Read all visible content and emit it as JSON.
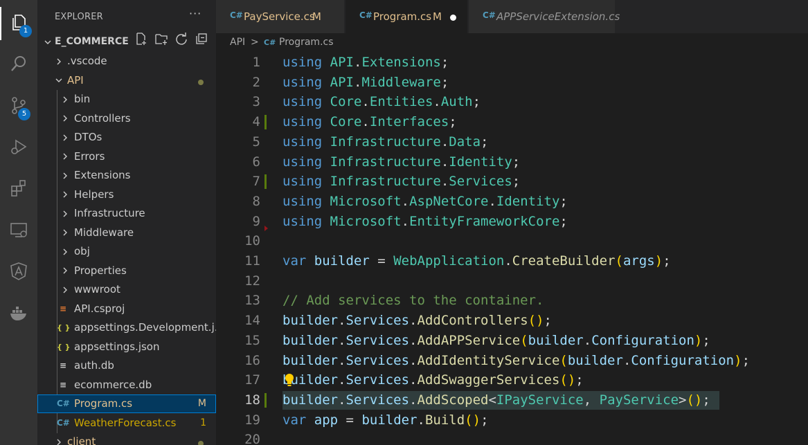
{
  "activity_bar": {
    "items": [
      {
        "name": "explorer-icon",
        "badge": "1"
      },
      {
        "name": "search-icon",
        "badge": null
      },
      {
        "name": "source-control-icon",
        "badge": "5"
      },
      {
        "name": "run-debug-icon",
        "badge": null
      },
      {
        "name": "extensions-icon",
        "badge": null
      },
      {
        "name": "remote-explorer-icon",
        "badge": null
      },
      {
        "name": "angular-icon",
        "badge": null
      },
      {
        "name": "docker-icon",
        "badge": null
      }
    ]
  },
  "sidebar": {
    "title": "EXPLORER",
    "more": "···",
    "project": "E_COMMERCE",
    "items": [
      {
        "label": ".vscode",
        "type": "folder"
      },
      {
        "label": "API",
        "type": "folder-open",
        "status": "dot"
      },
      {
        "label": "bin",
        "type": "folder"
      },
      {
        "label": "Controllers",
        "type": "folder"
      },
      {
        "label": "DTOs",
        "type": "folder"
      },
      {
        "label": "Errors",
        "type": "folder"
      },
      {
        "label": "Extensions",
        "type": "folder"
      },
      {
        "label": "Helpers",
        "type": "folder"
      },
      {
        "label": "Infrastructure",
        "type": "folder"
      },
      {
        "label": "Middleware",
        "type": "folder"
      },
      {
        "label": "obj",
        "type": "folder"
      },
      {
        "label": "Properties",
        "type": "folder"
      },
      {
        "label": "wwwroot",
        "type": "folder"
      },
      {
        "label": "API.csproj",
        "type": "rss"
      },
      {
        "label": "appsettings.Development.j...",
        "type": "json"
      },
      {
        "label": "appsettings.json",
        "type": "json"
      },
      {
        "label": "auth.db",
        "type": "db"
      },
      {
        "label": "ecommerce.db",
        "type": "db"
      },
      {
        "label": "Program.cs",
        "type": "cs",
        "status": "M",
        "selected": true
      },
      {
        "label": "WeatherForecast.cs",
        "type": "cs",
        "status": "1"
      },
      {
        "label": "client",
        "type": "folder",
        "status": "dot"
      }
    ]
  },
  "tabs": [
    {
      "icon": "C#",
      "label": "PayService.cs",
      "modified": "M"
    },
    {
      "icon": "C#",
      "label": "Program.cs",
      "modified": "M",
      "active": true
    },
    {
      "icon": "C#",
      "label": "APPServiceExtension.cs"
    }
  ],
  "breadcrumb": {
    "folder": "API",
    "sep": ">",
    "icon": "C#",
    "file": "Program.cs"
  },
  "code": {
    "lines": [
      {
        "n": "1",
        "tokens": [
          [
            "k",
            "using"
          ],
          [
            "w",
            " "
          ],
          [
            "ns",
            "API"
          ],
          [
            "w",
            "."
          ],
          [
            "ns",
            "Extensions"
          ],
          [
            "w",
            ";"
          ]
        ]
      },
      {
        "n": "2",
        "tokens": [
          [
            "k",
            "using"
          ],
          [
            "w",
            " "
          ],
          [
            "ns",
            "API"
          ],
          [
            "w",
            "."
          ],
          [
            "ns",
            "Middleware"
          ],
          [
            "w",
            ";"
          ]
        ]
      },
      {
        "n": "3",
        "tokens": [
          [
            "k",
            "using"
          ],
          [
            "w",
            " "
          ],
          [
            "ns",
            "Core"
          ],
          [
            "w",
            "."
          ],
          [
            "ns",
            "Entities"
          ],
          [
            "w",
            "."
          ],
          [
            "ns",
            "Auth"
          ],
          [
            "w",
            ";"
          ]
        ]
      },
      {
        "n": "4",
        "git": "added",
        "tokens": [
          [
            "k",
            "using"
          ],
          [
            "w",
            " "
          ],
          [
            "ns",
            "Core"
          ],
          [
            "w",
            "."
          ],
          [
            "ns",
            "Interfaces"
          ],
          [
            "w",
            ";"
          ]
        ]
      },
      {
        "n": "5",
        "tokens": [
          [
            "k",
            "using"
          ],
          [
            "w",
            " "
          ],
          [
            "ns",
            "Infrastructure"
          ],
          [
            "w",
            "."
          ],
          [
            "ns",
            "Data"
          ],
          [
            "w",
            ";"
          ]
        ]
      },
      {
        "n": "6",
        "tokens": [
          [
            "k",
            "using"
          ],
          [
            "w",
            " "
          ],
          [
            "ns",
            "Infrastructure"
          ],
          [
            "w",
            "."
          ],
          [
            "ns",
            "Identity"
          ],
          [
            "w",
            ";"
          ]
        ]
      },
      {
        "n": "7",
        "git": "added",
        "tokens": [
          [
            "k",
            "using"
          ],
          [
            "w",
            " "
          ],
          [
            "ns",
            "Infrastructure"
          ],
          [
            "w",
            "."
          ],
          [
            "ns",
            "Services"
          ],
          [
            "w",
            ";"
          ]
        ]
      },
      {
        "n": "8",
        "tokens": [
          [
            "k",
            "using"
          ],
          [
            "w",
            " "
          ],
          [
            "ns",
            "Microsoft"
          ],
          [
            "w",
            "."
          ],
          [
            "ns",
            "AspNetCore"
          ],
          [
            "w",
            "."
          ],
          [
            "ns",
            "Identity"
          ],
          [
            "w",
            ";"
          ]
        ]
      },
      {
        "n": "9",
        "git": "deleted",
        "tokens": [
          [
            "k",
            "using"
          ],
          [
            "w",
            " "
          ],
          [
            "ns",
            "Microsoft"
          ],
          [
            "w",
            "."
          ],
          [
            "ns",
            "EntityFrameworkCore"
          ],
          [
            "w",
            ";"
          ]
        ]
      },
      {
        "n": "10",
        "tokens": []
      },
      {
        "n": "11",
        "tokens": [
          [
            "k",
            "var"
          ],
          [
            "w",
            " "
          ],
          [
            "v",
            "builder"
          ],
          [
            "w",
            " = "
          ],
          [
            "ns",
            "WebApplication"
          ],
          [
            "w",
            "."
          ],
          [
            "f",
            "CreateBuilder"
          ],
          [
            "p1",
            "("
          ],
          [
            "v",
            "args"
          ],
          [
            "p1",
            ")"
          ],
          [
            "w",
            ";"
          ]
        ]
      },
      {
        "n": "12",
        "tokens": []
      },
      {
        "n": "13",
        "tokens": [
          [
            "c",
            "// Add services to the container."
          ]
        ]
      },
      {
        "n": "14",
        "tokens": [
          [
            "v",
            "builder"
          ],
          [
            "w",
            "."
          ],
          [
            "v",
            "Services"
          ],
          [
            "w",
            "."
          ],
          [
            "f",
            "AddControllers"
          ],
          [
            "p1",
            "()"
          ],
          [
            "w",
            ";"
          ]
        ]
      },
      {
        "n": "15",
        "tokens": [
          [
            "v",
            "builder"
          ],
          [
            "w",
            "."
          ],
          [
            "v",
            "Services"
          ],
          [
            "w",
            "."
          ],
          [
            "f",
            "AddAPPService"
          ],
          [
            "p1",
            "("
          ],
          [
            "v",
            "builder"
          ],
          [
            "w",
            "."
          ],
          [
            "v",
            "Configuration"
          ],
          [
            "p1",
            ")"
          ],
          [
            "w",
            ";"
          ]
        ]
      },
      {
        "n": "16",
        "tokens": [
          [
            "v",
            "builder"
          ],
          [
            "w",
            "."
          ],
          [
            "v",
            "Services"
          ],
          [
            "w",
            "."
          ],
          [
            "f",
            "AddIdentityService"
          ],
          [
            "p1",
            "("
          ],
          [
            "v",
            "builder"
          ],
          [
            "w",
            "."
          ],
          [
            "v",
            "Configuration"
          ],
          [
            "p1",
            ")"
          ],
          [
            "w",
            ";"
          ]
        ]
      },
      {
        "n": "17",
        "bulb": true,
        "tokens": [
          [
            "v",
            "builder"
          ],
          [
            "w",
            "."
          ],
          [
            "v",
            "Services"
          ],
          [
            "w",
            "."
          ],
          [
            "f",
            "AddSwaggerServices"
          ],
          [
            "p1",
            "()"
          ],
          [
            "w",
            ";"
          ]
        ]
      },
      {
        "n": "18",
        "git": "added",
        "current": true,
        "tokens": [
          [
            "v",
            "builder"
          ],
          [
            "w",
            "."
          ],
          [
            "v",
            "Services"
          ],
          [
            "w",
            "."
          ],
          [
            "f",
            "AddScoped"
          ],
          [
            "w",
            "<"
          ],
          [
            "ns",
            "IPayService"
          ],
          [
            "w",
            ", "
          ],
          [
            "ns",
            "PayService"
          ],
          [
            "w",
            ">"
          ],
          [
            "p1",
            "()"
          ],
          [
            "w",
            ";"
          ]
        ]
      },
      {
        "n": "19",
        "tokens": [
          [
            "k",
            "var"
          ],
          [
            "w",
            " "
          ],
          [
            "v",
            "app"
          ],
          [
            "w",
            " = "
          ],
          [
            "v",
            "builder"
          ],
          [
            "w",
            "."
          ],
          [
            "f",
            "Build"
          ],
          [
            "p1",
            "()"
          ],
          [
            "w",
            ";"
          ]
        ]
      },
      {
        "n": "20",
        "tokens": []
      }
    ]
  },
  "colors": {
    "activity_bg": "#333333",
    "sidebar_bg": "#252526",
    "editor_bg": "#1e1e1e",
    "modified": "#e2c08d",
    "cs_icon": "#519aba",
    "json_icon": "#cbcb41"
  }
}
